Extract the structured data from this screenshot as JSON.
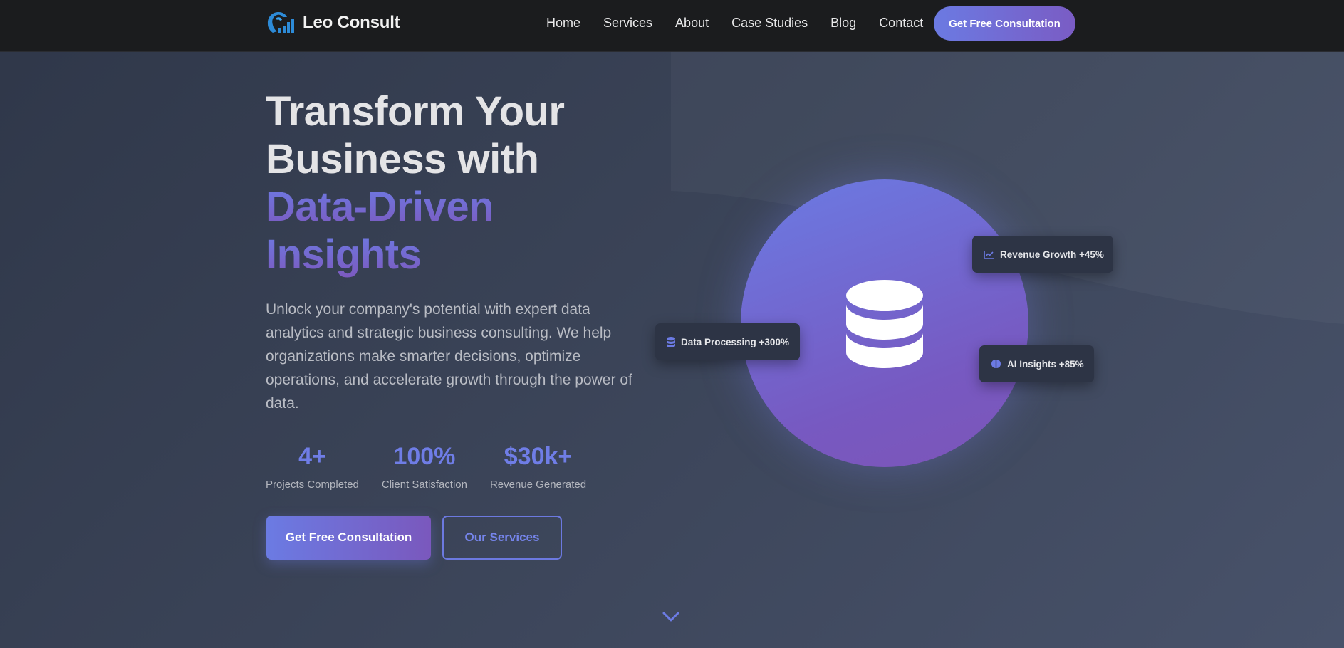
{
  "nav": {
    "brand": "Leo Consult",
    "links": [
      "Home",
      "Services",
      "About",
      "Case Studies",
      "Blog",
      "Contact"
    ],
    "cta": "Get Free Consultation"
  },
  "hero": {
    "title_line1": "Transform Your",
    "title_line2": "Business with",
    "title_line3": "Data-Driven",
    "title_line4": "Insights",
    "description": "Unlock your company's potential with expert data analytics and strategic business consulting. We help organizations make smarter decisions, optimize operations, and accelerate growth through the power of data.",
    "stats": [
      {
        "value": "4+",
        "label": "Projects Completed"
      },
      {
        "value": "100%",
        "label": "Client Satisfaction"
      },
      {
        "value": "$30k+",
        "label": "Revenue Generated"
      }
    ],
    "primary_button": "Get Free Consultation",
    "secondary_button": "Our Services"
  },
  "visual": {
    "cards": [
      {
        "icon": "chart-line-icon",
        "text": "Revenue Growth +45%"
      },
      {
        "icon": "database-icon",
        "text": "Data Processing +300%"
      },
      {
        "icon": "brain-icon",
        "text": "AI Insights +85%"
      }
    ],
    "center_icon": "database-icon"
  },
  "colors": {
    "accent": "#6c7be4",
    "accent_purple": "#7a58bd",
    "nav_bg": "#1b1c1e",
    "card_bg": "#2d3445"
  }
}
